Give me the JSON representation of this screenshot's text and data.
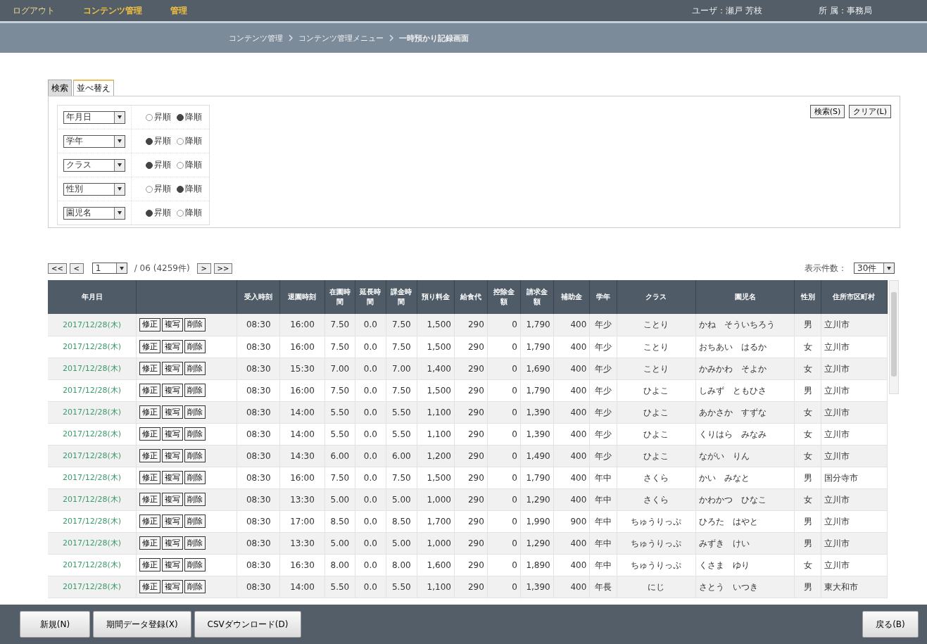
{
  "header": {
    "links": [
      {
        "label": "ログアウト",
        "selected": false
      },
      {
        "label": "コンテンツ管理",
        "selected": true
      },
      {
        "label": "管理",
        "selected": true
      }
    ],
    "user": "ユーザ：瀬戸 芳枝",
    "affiliation": "所 属：事務局"
  },
  "breadcrumb": [
    "コンテンツ管理",
    "コンテンツ管理メニュー",
    "一時預かり記録画面"
  ],
  "tabs": [
    {
      "label": "検索",
      "selected": false
    },
    {
      "label": "並べ替え",
      "selected": true
    }
  ],
  "sort_rows": [
    {
      "field": "年月日",
      "options": [
        {
          "label": "昇順",
          "selected": false
        },
        {
          "label": "降順",
          "selected": true
        }
      ]
    },
    {
      "field": "学年",
      "options": [
        {
          "label": "昇順",
          "selected": true
        },
        {
          "label": "降順",
          "selected": false
        }
      ]
    },
    {
      "field": "クラス",
      "options": [
        {
          "label": "昇順",
          "selected": true
        },
        {
          "label": "降順",
          "selected": false
        }
      ]
    },
    {
      "field": "性別",
      "options": [
        {
          "label": "昇順",
          "selected": false
        },
        {
          "label": "降順",
          "selected": true
        }
      ]
    },
    {
      "field": "園児名",
      "options": [
        {
          "label": "昇順",
          "selected": true
        },
        {
          "label": "降順",
          "selected": false
        }
      ]
    }
  ],
  "panel_buttons": [
    "検索(S)",
    "クリア(L)"
  ],
  "pager": {
    "first": "<<",
    "prev": "<",
    "page": "1",
    "total": "/ 06 (4259件)",
    "next": ">",
    "last": ">>",
    "per_page_label": "表示件数：",
    "per_page": "30件"
  },
  "table": {
    "date_column": "年月日",
    "columns": [
      "受入時刻",
      "退園時刻",
      "在園時間",
      "延長時間",
      "課金時間",
      "預り料金",
      "給食代",
      "控除金額",
      "請求金額",
      "補助金",
      "学年",
      "クラス",
      "園児名",
      "性別",
      "住所市区町村"
    ],
    "rows": [
      {
        "date": "2017/12/28(木)",
        "actions": [
          "修正",
          "複写",
          "削除"
        ],
        "cells": [
          "08:30",
          "16:00",
          "7.50",
          "0.0",
          "7.50",
          "1,500",
          "290",
          "0",
          "1,790",
          "400",
          "年少",
          "ことり",
          "かね　そういちろう",
          "男",
          "立川市"
        ]
      },
      {
        "date": "2017/12/28(木)",
        "actions": [
          "修正",
          "複写",
          "削除"
        ],
        "cells": [
          "08:30",
          "16:00",
          "7.50",
          "0.0",
          "7.50",
          "1,500",
          "290",
          "0",
          "1,790",
          "400",
          "年少",
          "ことり",
          "おちあい　はるか",
          "女",
          "立川市"
        ]
      },
      {
        "date": "2017/12/28(木)",
        "actions": [
          "修正",
          "複写",
          "削除"
        ],
        "cells": [
          "08:30",
          "15:30",
          "7.00",
          "0.0",
          "7.00",
          "1,400",
          "290",
          "0",
          "1,690",
          "400",
          "年少",
          "ことり",
          "かみかわ　そよか",
          "女",
          "立川市"
        ]
      },
      {
        "date": "2017/12/28(木)",
        "actions": [
          "修正",
          "複写",
          "削除"
        ],
        "cells": [
          "08:30",
          "16:00",
          "7.50",
          "0.0",
          "7.50",
          "1,500",
          "290",
          "0",
          "1,790",
          "400",
          "年少",
          "ひよこ",
          "しみず　ともひさ",
          "男",
          "立川市"
        ]
      },
      {
        "date": "2017/12/28(木)",
        "actions": [
          "修正",
          "複写",
          "削除"
        ],
        "cells": [
          "08:30",
          "14:00",
          "5.50",
          "0.0",
          "5.50",
          "1,100",
          "290",
          "0",
          "1,390",
          "400",
          "年少",
          "ひよこ",
          "あかさか　すずな",
          "女",
          "立川市"
        ]
      },
      {
        "date": "2017/12/28(木)",
        "actions": [
          "修正",
          "複写",
          "削除"
        ],
        "cells": [
          "08:30",
          "14:00",
          "5.50",
          "0.0",
          "5.50",
          "1,100",
          "290",
          "0",
          "1,390",
          "400",
          "年少",
          "ひよこ",
          "くりはら　みなみ",
          "女",
          "立川市"
        ]
      },
      {
        "date": "2017/12/28(木)",
        "actions": [
          "修正",
          "複写",
          "削除"
        ],
        "cells": [
          "08:30",
          "14:30",
          "6.00",
          "0.0",
          "6.00",
          "1,200",
          "290",
          "0",
          "1,490",
          "400",
          "年少",
          "ひよこ",
          "ながい　りん",
          "女",
          "立川市"
        ]
      },
      {
        "date": "2017/12/28(木)",
        "actions": [
          "修正",
          "複写",
          "削除"
        ],
        "cells": [
          "08:30",
          "16:00",
          "7.50",
          "0.0",
          "7.50",
          "1,500",
          "290",
          "0",
          "1,790",
          "400",
          "年中",
          "さくら",
          "かい　みなと",
          "男",
          "国分寺市"
        ]
      },
      {
        "date": "2017/12/28(木)",
        "actions": [
          "修正",
          "複写",
          "削除"
        ],
        "cells": [
          "08:30",
          "13:30",
          "5.00",
          "0.0",
          "5.00",
          "1,000",
          "290",
          "0",
          "1,290",
          "400",
          "年中",
          "さくら",
          "かわかつ　ひなこ",
          "女",
          "立川市"
        ]
      },
      {
        "date": "2017/12/28(木)",
        "actions": [
          "修正",
          "複写",
          "削除"
        ],
        "cells": [
          "08:30",
          "17:00",
          "8.50",
          "0.0",
          "8.50",
          "1,700",
          "290",
          "0",
          "1,990",
          "900",
          "年中",
          "ちゅうりっぷ",
          "ひろた　はやと",
          "男",
          "立川市"
        ]
      },
      {
        "date": "2017/12/28(木)",
        "actions": [
          "修正",
          "複写",
          "削除"
        ],
        "cells": [
          "08:30",
          "13:30",
          "5.00",
          "0.0",
          "5.00",
          "1,000",
          "290",
          "0",
          "1,290",
          "400",
          "年中",
          "ちゅうりっぷ",
          "みずき　けい",
          "男",
          "立川市"
        ]
      },
      {
        "date": "2017/12/28(木)",
        "actions": [
          "修正",
          "複写",
          "削除"
        ],
        "cells": [
          "08:30",
          "16:30",
          "8.00",
          "0.0",
          "8.00",
          "1,600",
          "290",
          "0",
          "1,890",
          "400",
          "年中",
          "ちゅうりっぷ",
          "くさま　ゆり",
          "女",
          "立川市"
        ]
      },
      {
        "date": "2017/12/28(木)",
        "actions": [
          "修正",
          "複写",
          "削除"
        ],
        "cells": [
          "08:30",
          "14:00",
          "5.50",
          "0.0",
          "5.50",
          "1,100",
          "290",
          "0",
          "1,390",
          "400",
          "年長",
          "にじ",
          "さとう　いつき",
          "男",
          "東大和市"
        ]
      }
    ]
  },
  "footer_buttons": [
    "新規(N)",
    "期間データ登録(X)",
    "CSVダウンロード(D)"
  ],
  "back_button": "戻る(B)"
}
